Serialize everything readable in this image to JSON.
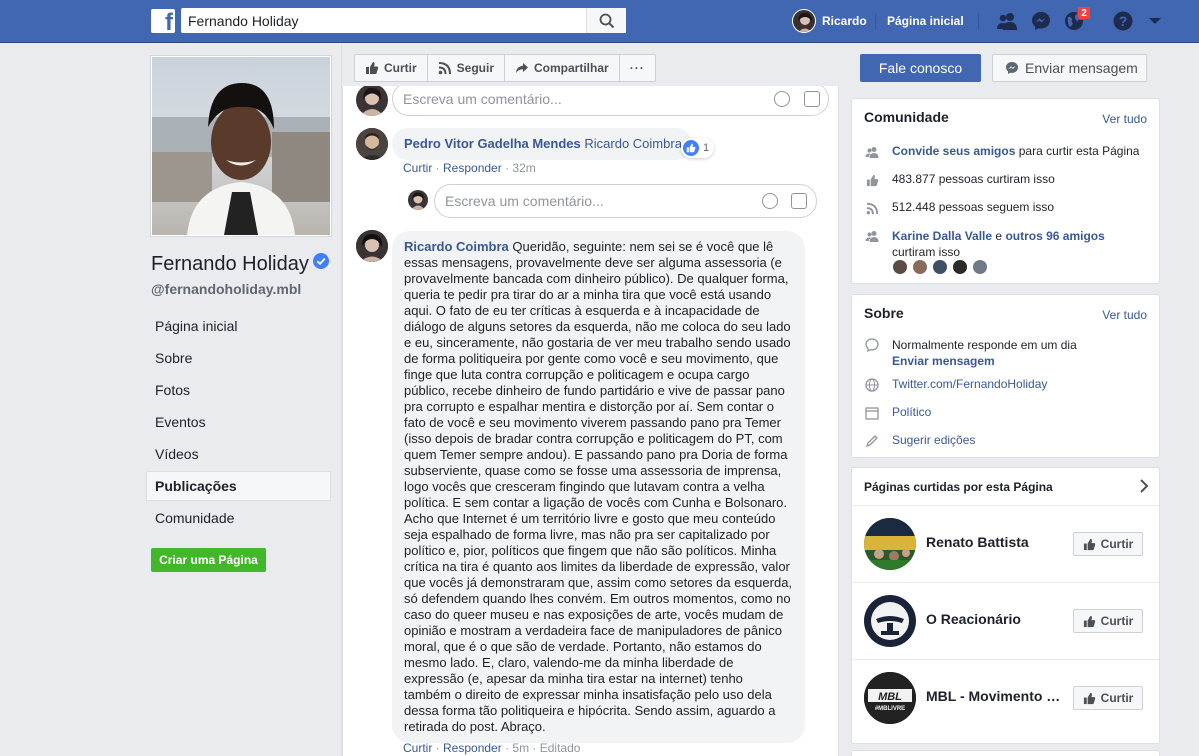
{
  "topbar": {
    "search_value": "Fernando Holiday",
    "username": "Ricardo",
    "home_label": "Página inicial",
    "notification_count": "2",
    "icons": [
      "facebook-logo-icon",
      "search-icon",
      "friend-requests-icon",
      "messenger-icon",
      "globe-notifications-icon",
      "help-icon",
      "dropdown-caret-icon"
    ]
  },
  "profile": {
    "name": "Fernando Holiday",
    "handle": "@fernandoholiday.mbl"
  },
  "left_nav": {
    "items": [
      {
        "label": "Página inicial"
      },
      {
        "label": "Sobre"
      },
      {
        "label": "Fotos"
      },
      {
        "label": "Eventos"
      },
      {
        "label": "Vídeos"
      },
      {
        "label": "Publicações"
      },
      {
        "label": "Comunidade"
      }
    ],
    "active": "Publicações",
    "create_page": "Criar uma Página"
  },
  "actions": {
    "like": "Curtir",
    "follow": "Seguir",
    "share": "Compartilhar",
    "more": "···",
    "contact": "Fale conosco",
    "message": "Enviar mensagem"
  },
  "feed": {
    "comment_placeholder": "Escreva um comentário...",
    "comment1": {
      "author": "Pedro Vitor Gadelha Mendes",
      "text": "Ricardo Coimbra",
      "likes": "1",
      "like": "Curtir",
      "reply": "Responder",
      "time": "32m"
    },
    "comment2": {
      "author": "Ricardo Coimbra",
      "text": "Queridão, seguinte: nem sei se é você que lê essas mensagens, provavelmente deve ser alguma assessoria (e provavelmente bancada com dinheiro público). De qualquer forma, queria te pedir pra tirar do ar a minha tira que você está usando aqui. O fato de eu ter críticas à esquerda e à incapacidade de diálogo de alguns setores da esquerda, não me coloca do seu lado e eu, sinceramente, não gostaria de ver meu trabalho sendo usado de forma politiqueira por gente como você e seu movimento, que finge que luta contra corrupção e politicagem e ocupa cargo público, recebe dinheiro de fundo partidário e vive de passar pano pra corrupto e espalhar mentira e distorção por aí. Sem contar o fato de você e seu movimento viverem passando pano pra Temer (isso depois de bradar contra corrupção e politicagem do PT, com quem Temer sempre andou). E passando pano pra Doria de forma subserviente, quase como se fosse uma assessoria de imprensa, logo vocês que cresceram fingindo que lutavam contra a velha política. E sem contar a ligação de vocês com Cunha e Bolsonaro. Acho que Internet é um território livre e gosto que meu conteúdo seja espalhado de forma livre, mas não pra ser capitalizado por político e, pior, políticos que fingem que não são políticos. Minha crítica na tira é quanto aos limites da liberdade de expressão, valor que vocês já demonstraram que, assim como setores da esquerda, só defendem quando lhes convém. Em outros momentos, como no caso do queer museu e nas exposições de arte, vocês mudam de opinião e mostram a verdadeira face de manipuladores de pânico moral, que é o que são de verdade. Portanto, não estamos do mesmo lado. E, claro, valendo-me da minha liberdade de expressão (e, apesar da minha tira estar na internet) tenho também o direito de expressar minha insatisfação pelo uso dela dessa forma tão politiqueira e hipócrita. Sendo assim, aguardo a retirada do post. Abraço.",
      "like": "Curtir",
      "reply": "Responder",
      "time": "5m",
      "edited": "Editado"
    }
  },
  "community": {
    "title": "Comunidade",
    "see_all": "Ver tudo",
    "invite_link": "Convide seus amigos",
    "invite_rest": "para curtir esta Página",
    "likes": "483.877 pessoas curtiram isso",
    "follows": "512.448 pessoas seguem isso",
    "friends_a": "Karine Dalla Valle",
    "friends_and": "e",
    "friends_b": "outros 96 amigos",
    "friends_rest": "curtiram isso"
  },
  "about": {
    "title": "Sobre",
    "see_all": "Ver tudo",
    "response": "Normalmente responde em um dia",
    "send_message": "Enviar mensagem",
    "website": "Twitter.com/FernandoHoliday",
    "category": "Político",
    "suggest": "Sugerir edições"
  },
  "liked_pages": {
    "title": "Páginas curtidas por esta Página",
    "pages": [
      {
        "name": "Renato Battista",
        "button": "Curtir"
      },
      {
        "name": "O Reacionário",
        "button": "Curtir"
      },
      {
        "name": "MBL - Movimento Brasil Livre",
        "button": "Curtir"
      }
    ],
    "mbl_logo_text": "MBL",
    "mbl_logo_sub": "#MBLIVRE"
  },
  "colors": {
    "brand": "#4267b2",
    "link": "#385898",
    "green": "#42b72a",
    "badge": "#fa3e3e"
  }
}
